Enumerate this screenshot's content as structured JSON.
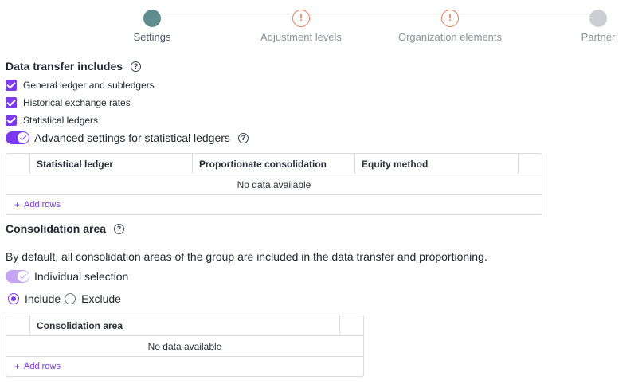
{
  "stepper": {
    "steps": [
      {
        "label": "Settings",
        "state": "active",
        "color": "#5d8d8c"
      },
      {
        "label": "Adjustment levels",
        "state": "warning",
        "icon": "exclamation-icon",
        "color": "#e07b5a"
      },
      {
        "label": "Organization elements",
        "state": "warning",
        "icon": "exclamation-icon",
        "color": "#e07b5a"
      },
      {
        "label": "Partner",
        "state": "pending",
        "color": "#cbced3"
      }
    ]
  },
  "data_transfer": {
    "title": "Data transfer includes",
    "help_icon": "?",
    "checkboxes": [
      {
        "label": "General ledger and subledgers",
        "checked": true
      },
      {
        "label": "Historical exchange rates",
        "checked": true
      },
      {
        "label": "Statistical ledgers",
        "checked": true
      }
    ],
    "advanced_toggle": {
      "label": "Advanced settings for statistical ledgers",
      "on": true
    },
    "table": {
      "columns": [
        "Statistical ledger",
        "Proportionate consolidation",
        "Equity method"
      ],
      "empty_text": "No data available",
      "add_rows": "Add rows",
      "add_symbol": "+"
    }
  },
  "consolidation": {
    "title": "Consolidation area",
    "help_icon": "?",
    "description": "By default, all consolidation areas of the group are included in the data transfer and proportioning.",
    "individual_toggle": {
      "label": "Individual selection",
      "on": true
    },
    "radio": {
      "include": "Include",
      "exclude": "Exclude",
      "selected": "Include"
    },
    "table": {
      "columns": [
        "Consolidation area"
      ],
      "empty_text": "No data available",
      "add_rows": "Add rows",
      "add_symbol": "+"
    }
  },
  "colors": {
    "accent": "#7c3aed",
    "active_step": "#5d8d8c",
    "warning": "#e07b5a"
  }
}
